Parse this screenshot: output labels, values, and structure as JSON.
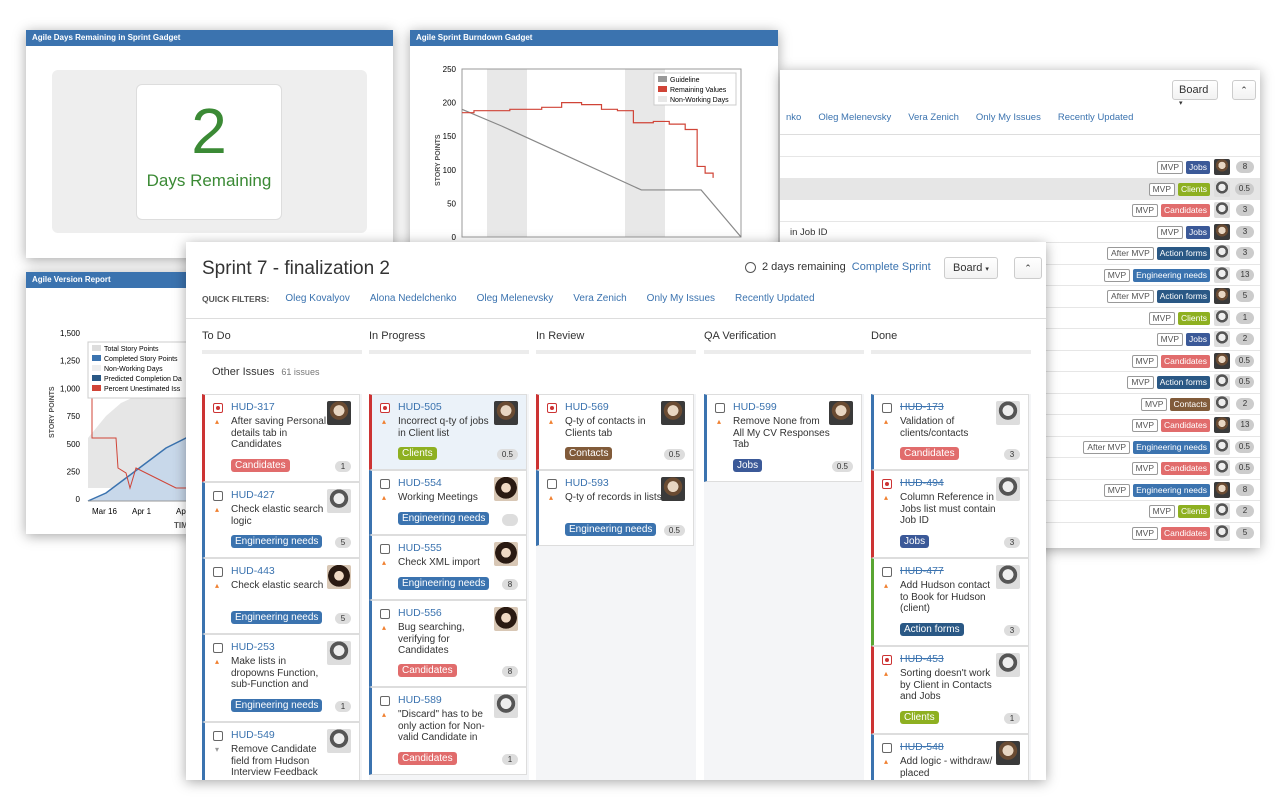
{
  "days_gadget": {
    "header": "Agile Days Remaining in Sprint Gadget",
    "number": "2",
    "label": "Days Remaining"
  },
  "burndown_gadget": {
    "header": "Agile Sprint Burndown Gadget",
    "ylabel": "STORY POINTS",
    "legend": [
      "Guideline",
      "Remaining Values",
      "Non-Working Days"
    ],
    "chart_data": {
      "type": "line",
      "ylabel": "STORY POINTS",
      "ylim": [
        0,
        250
      ],
      "yticks": [
        "250",
        "200",
        "150",
        "100",
        "50",
        "0"
      ],
      "series": [
        {
          "name": "Guideline",
          "x": [
            0,
            1,
            4.5,
            6,
            7
          ],
          "y": [
            190,
            165,
            70,
            70,
            0
          ]
        },
        {
          "name": "Remaining Values",
          "x": [
            0,
            0.3,
            1.2,
            2,
            2.5,
            3,
            3.5,
            3.9,
            4.3,
            4.8,
            5.2,
            5.6,
            5.9,
            6.1,
            6.3
          ],
          "y": [
            185,
            188,
            190,
            193,
            200,
            197,
            190,
            188,
            170,
            172,
            168,
            160,
            105,
            95,
            88
          ]
        }
      ],
      "legend": "top-right"
    }
  },
  "version_gadget": {
    "header": "Agile Version Report",
    "ylabel": "STORY POINTS",
    "xlabel": "TIM",
    "legend": [
      "Total Story Points",
      "Completed Story Points",
      "Non-Working Days",
      "Predicted Completion Da",
      "Percent Unestimated Iss"
    ],
    "chart_data": {
      "type": "line",
      "ylabel": "STORY POINTS",
      "yticks": [
        "1,500",
        "1,250",
        "1,000",
        "750",
        "500",
        "250",
        "0"
      ],
      "xticks": [
        "Mar 16",
        "Apr 1",
        "Apr 16"
      ],
      "ylim": [
        0,
        1500
      ]
    }
  },
  "list_panel": {
    "board_btn": "Board",
    "filters": [
      "nko",
      "Oleg Melenevsky",
      "Vera Zenich",
      "Only My Issues",
      "Recently Updated"
    ],
    "rows": [
      {
        "text": "",
        "tags": [
          {
            "t": "MVP",
            "o": true
          },
          {
            "t": "Jobs",
            "c": "#3b5998"
          }
        ],
        "pts": "8"
      },
      {
        "text": "",
        "tags": [
          {
            "t": "MVP",
            "o": true
          },
          {
            "t": "Clients",
            "c": "#8eb021"
          }
        ],
        "pts": "0.5"
      },
      {
        "text": "",
        "tags": [
          {
            "t": "MVP",
            "o": true
          },
          {
            "t": "Candidates",
            "c": "#e16c6c"
          }
        ],
        "pts": "3"
      },
      {
        "text": "in Job ID",
        "tags": [
          {
            "t": "MVP",
            "o": true
          },
          {
            "t": "Jobs",
            "c": "#3b5998"
          }
        ],
        "pts": "3"
      },
      {
        "text": "",
        "tags": [
          {
            "t": "After MVP",
            "o": true
          },
          {
            "t": "Action forms",
            "c": "#2a5885"
          }
        ],
        "pts": "3"
      },
      {
        "text": "",
        "tags": [
          {
            "t": "MVP",
            "o": true
          },
          {
            "t": "Engineering needs",
            "c": "#3b73af"
          }
        ],
        "pts": "13"
      },
      {
        "text": "",
        "tags": [
          {
            "t": "After MVP",
            "o": true
          },
          {
            "t": "Action forms",
            "c": "#2a5885"
          }
        ],
        "pts": "5"
      },
      {
        "text": "",
        "tags": [
          {
            "t": "MVP",
            "o": true
          },
          {
            "t": "Clients",
            "c": "#8eb021"
          }
        ],
        "pts": "1"
      },
      {
        "text": "",
        "tags": [
          {
            "t": "MVP",
            "o": true
          },
          {
            "t": "Jobs",
            "c": "#3b5998"
          }
        ],
        "pts": "2"
      },
      {
        "text": "",
        "tags": [
          {
            "t": "MVP",
            "o": true
          },
          {
            "t": "Candidates",
            "c": "#e16c6c"
          }
        ],
        "pts": "0.5"
      },
      {
        "text": "",
        "tags": [
          {
            "t": "MVP",
            "o": true
          },
          {
            "t": "Action forms",
            "c": "#2a5885"
          }
        ],
        "pts": "0.5"
      },
      {
        "text": "",
        "tags": [
          {
            "t": "MVP",
            "o": true
          },
          {
            "t": "Contacts",
            "c": "#815b3a"
          }
        ],
        "pts": "2"
      },
      {
        "text": "",
        "tags": [
          {
            "t": "MVP",
            "o": true
          },
          {
            "t": "Candidates",
            "c": "#e16c6c"
          }
        ],
        "pts": "13"
      },
      {
        "text": "",
        "tags": [
          {
            "t": "After MVP",
            "o": true
          },
          {
            "t": "Engineering needs",
            "c": "#3b73af"
          }
        ],
        "pts": "0.5"
      },
      {
        "text": "",
        "tags": [
          {
            "t": "MVP",
            "o": true
          },
          {
            "t": "Candidates",
            "c": "#e16c6c"
          }
        ],
        "pts": "0.5"
      },
      {
        "text": "",
        "tags": [
          {
            "t": "MVP",
            "o": true
          },
          {
            "t": "Engineering needs",
            "c": "#3b73af"
          }
        ],
        "pts": "8"
      },
      {
        "text": "",
        "tags": [
          {
            "t": "MVP",
            "o": true
          },
          {
            "t": "Clients",
            "c": "#8eb021"
          }
        ],
        "pts": "2"
      },
      {
        "text": "",
        "tags": [
          {
            "t": "MVP",
            "o": true
          },
          {
            "t": "Candidates",
            "c": "#e16c6c"
          }
        ],
        "pts": "5"
      }
    ]
  },
  "board": {
    "title": "Sprint 7 - finalization 2",
    "remaining": "2 days remaining",
    "complete": "Complete Sprint",
    "board_btn": "Board",
    "quick_filters_label": "QUICK FILTERS:",
    "quick_filters": [
      "Oleg Kovalyov",
      "Alona Nedelchenko",
      "Oleg Melenevsky",
      "Vera Zenich",
      "Only My Issues",
      "Recently Updated"
    ],
    "swimlane": "Other Issues",
    "swimlane_count": "61 issues",
    "columns": [
      {
        "name": "To Do",
        "cards": [
          {
            "key": "HUD-317",
            "sum": "After saving Personal details tab in Candidates",
            "lbl": "Candidates",
            "lc": "#e16c6c",
            "pts": "1",
            "bug": true,
            "h": 88,
            "av": "c"
          },
          {
            "key": "HUD-427",
            "sum": "Check elastic search logic",
            "lbl": "Engineering needs",
            "lc": "#3b73af",
            "pts": "5",
            "h": 76,
            "av": "bw"
          },
          {
            "key": "HUD-443",
            "sum": "Check elastic search",
            "lbl": "Engineering needs",
            "lc": "#3b73af",
            "pts": "5",
            "h": 76,
            "av": "f"
          },
          {
            "key": "HUD-253",
            "sum": "Make lists in dropowns Function, sub-Function and",
            "lbl": "Engineering needs",
            "lc": "#3b73af",
            "pts": "1",
            "h": 88,
            "av": "bw"
          },
          {
            "key": "HUD-549",
            "sum": "Remove Candidate field from Hudson Interview Feedback",
            "lbl": "",
            "lc": "",
            "pts": "",
            "h": 60,
            "av": "bw",
            "lowpr": true
          }
        ]
      },
      {
        "name": "In Progress",
        "cards": [
          {
            "key": "HUD-505",
            "sum": "Incorrect q-ty of jobs in Client list",
            "lbl": "Clients",
            "lc": "#8eb021",
            "pts": "0.5",
            "bug": true,
            "h": 76,
            "av": "c",
            "hl": true
          },
          {
            "key": "HUD-554",
            "sum": "Working Meetings",
            "lbl": "Engineering needs",
            "lc": "#3b73af",
            "pts": "",
            "h": 65,
            "av": "f"
          },
          {
            "key": "HUD-555",
            "sum": "Check XML import",
            "lbl": "Engineering needs",
            "lc": "#3b73af",
            "pts": "8",
            "h": 65,
            "av": "f"
          },
          {
            "key": "HUD-556",
            "sum": "Bug searching, verifying for Candidates",
            "lbl": "Candidates",
            "lc": "#e16c6c",
            "pts": "8",
            "h": 87,
            "av": "f"
          },
          {
            "key": "HUD-589",
            "sum": "\"Discard\" has to be only action for Non-valid Candidate in",
            "lbl": "Candidates",
            "lc": "#e16c6c",
            "pts": "1",
            "h": 88,
            "av": "bw"
          }
        ]
      },
      {
        "name": "In Review",
        "cards": [
          {
            "key": "HUD-569",
            "sum": "Q-ty of contacts in Clients tab",
            "lbl": "Contacts",
            "lc": "#815b3a",
            "pts": "0.5",
            "bug": true,
            "h": 76,
            "av": "c"
          },
          {
            "key": "HUD-593",
            "sum": "Q-ty of records in lists",
            "lbl": "Engineering needs",
            "lc": "#3b73af",
            "pts": "0.5",
            "h": 76,
            "av": "c"
          }
        ]
      },
      {
        "name": "QA Verification",
        "cards": [
          {
            "key": "HUD-599",
            "sum": "Remove None from All My CV Responses Tab",
            "lbl": "Jobs",
            "lc": "#3b5998",
            "pts": "0.5",
            "h": 88,
            "av": "c"
          }
        ]
      },
      {
        "name": "Done",
        "cards": [
          {
            "key": "HUD-173",
            "sum": "Validation of clients/contacts",
            "lbl": "Candidates",
            "lc": "#e16c6c",
            "pts": "3",
            "h": 76,
            "av": "bw",
            "done": true
          },
          {
            "key": "HUD-494",
            "sum": "Column Reference in Jobs list must contain Job ID",
            "lbl": "Jobs",
            "lc": "#3b5998",
            "pts": "3",
            "bug": true,
            "h": 88,
            "av": "bw",
            "done": true
          },
          {
            "key": "HUD-477",
            "sum": "Add Hudson contact to Book for Hudson (client)",
            "lbl": "Action forms",
            "lc": "#2a5885",
            "pts": "3",
            "h": 88,
            "av": "bw",
            "done": true,
            "green": true
          },
          {
            "key": "HUD-453",
            "sum": "Sorting doesn't work by Client in Contacts and Jobs",
            "lbl": "Clients",
            "lc": "#8eb021",
            "pts": "1",
            "bug": true,
            "h": 88,
            "av": "bw",
            "done": true
          },
          {
            "key": "HUD-548",
            "sum": "Add logic - withdraw/ placed",
            "lbl": "",
            "lc": "",
            "pts": "",
            "h": 60,
            "av": "c",
            "done": true
          }
        ]
      }
    ]
  }
}
